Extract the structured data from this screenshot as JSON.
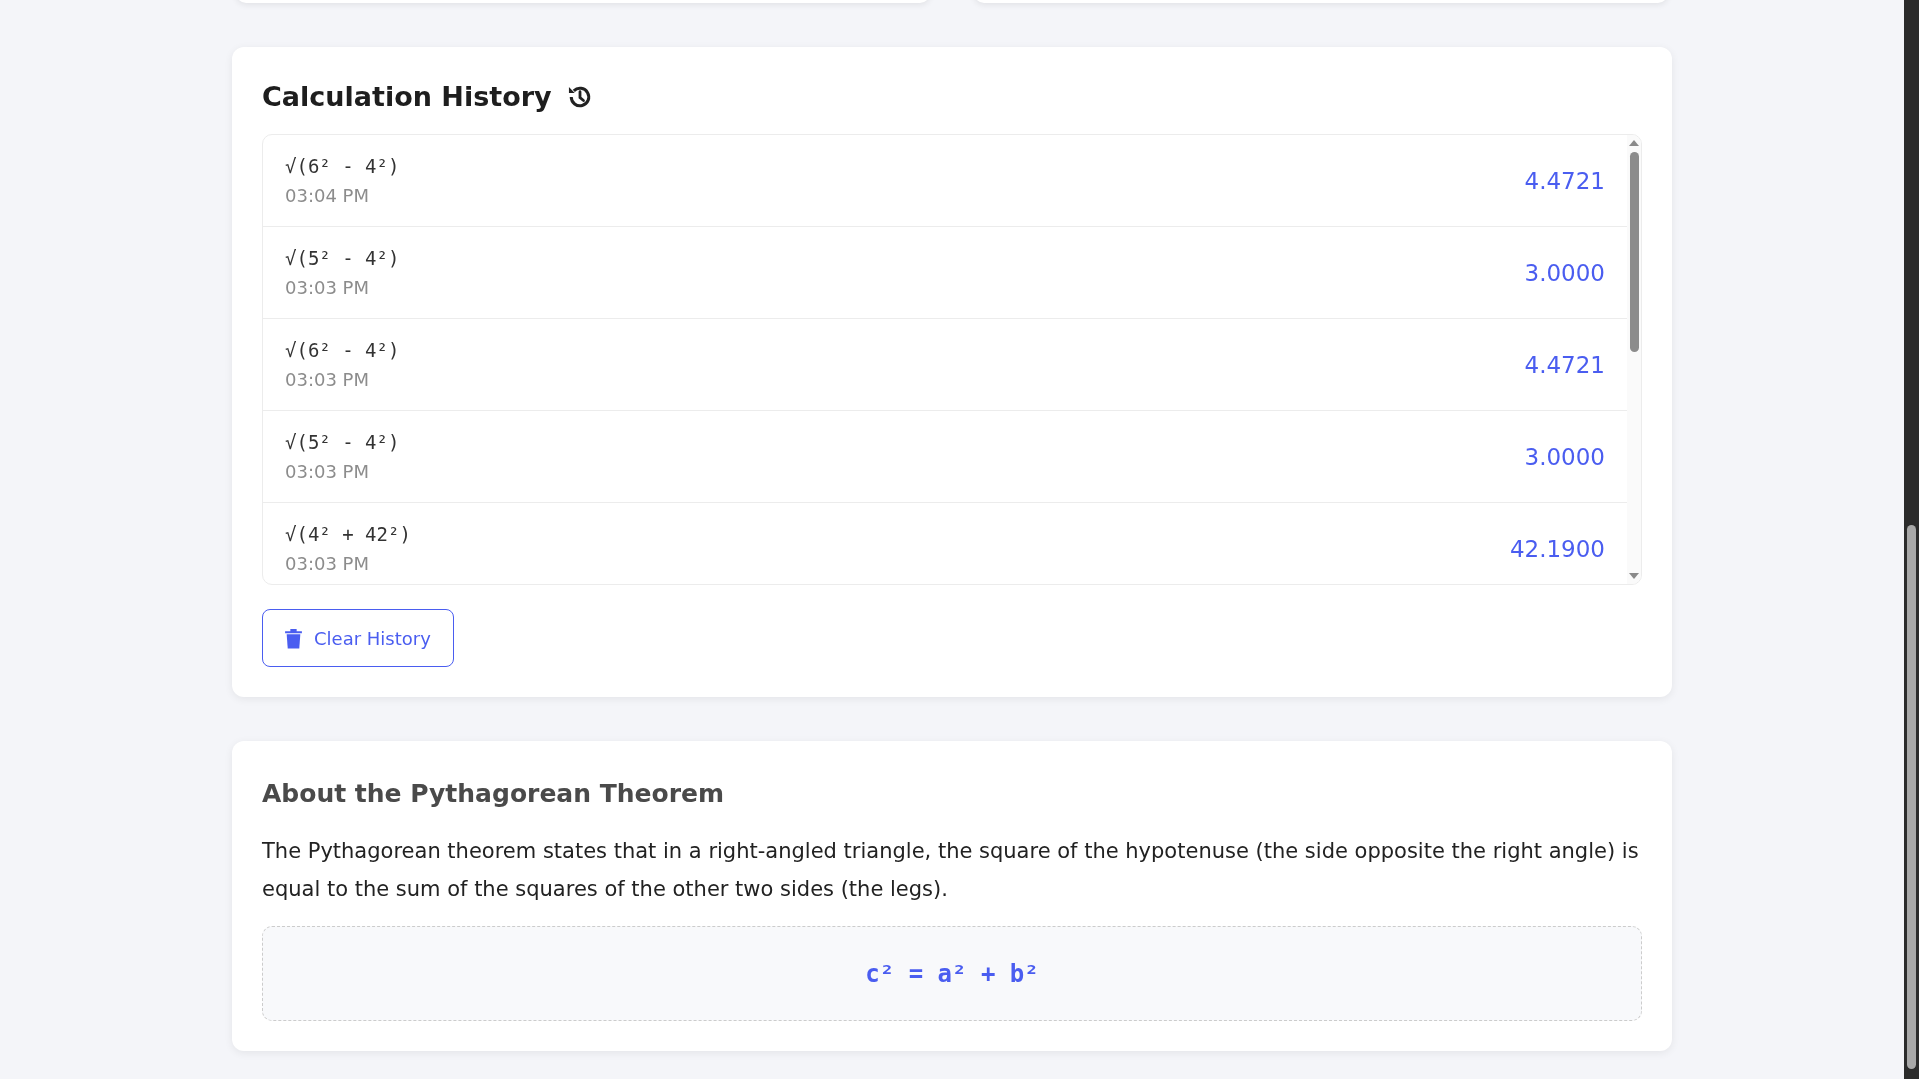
{
  "history": {
    "title": "Calculation History",
    "entries": [
      {
        "expression": "√(6² - 4²)",
        "time": "03:04 PM",
        "result": "4.4721"
      },
      {
        "expression": "√(5² - 4²)",
        "time": "03:03 PM",
        "result": "3.0000"
      },
      {
        "expression": "√(6² - 4²)",
        "time": "03:03 PM",
        "result": "4.4721"
      },
      {
        "expression": "√(5² - 4²)",
        "time": "03:03 PM",
        "result": "3.0000"
      },
      {
        "expression": "√(4² + 42²)",
        "time": "03:03 PM",
        "result": "42.1900"
      }
    ],
    "clear_button": "Clear History"
  },
  "about": {
    "title": "About the Pythagorean Theorem",
    "text": "The Pythagorean theorem states that in a right-angled triangle, the square of the hypotenuse (the side opposite the right angle) is equal to the sum of the squares of the other two sides (the legs).",
    "formula": "c² = a² + b²"
  }
}
